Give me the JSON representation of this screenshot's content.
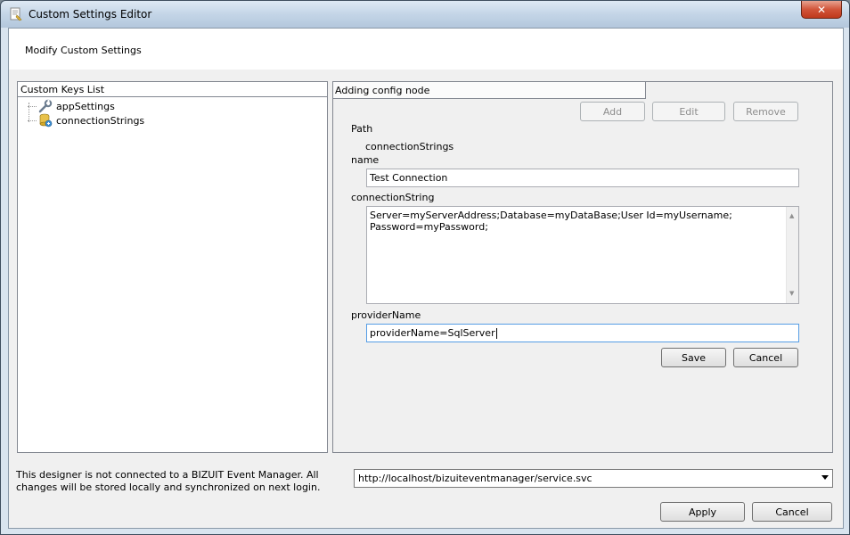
{
  "window": {
    "title": "Custom Settings Editor",
    "icon": "settings-document-icon",
    "close_glyph": "✕"
  },
  "header": {
    "text": "Modify Custom Settings"
  },
  "left_panel": {
    "title": "Custom Keys List",
    "tree_items": [
      {
        "label": "appSettings",
        "icon": "wrench-icon"
      },
      {
        "label": "connectionStrings",
        "icon": "database-connection-icon"
      }
    ]
  },
  "right_panel": {
    "tab_label": "Adding config node",
    "buttons": {
      "add": "Add",
      "edit": "Edit",
      "remove": "Remove",
      "save": "Save",
      "cancel": "Cancel"
    },
    "path_label": "Path",
    "path_value": "connectionStrings",
    "name_label": "name",
    "name_value": "Test Connection",
    "connection_label": "connectionString",
    "connection_value_line1": "Server=myServerAddress;Database=myDataBase;User Id=myUsername;",
    "connection_value_line2": "Password=myPassword;",
    "provider_label": "providerName",
    "provider_value": "providerName=SqlServer"
  },
  "footer": {
    "status_text": "This designer is not connected to a BIZUIT Event Manager. All changes will be stored locally and synchronized on next login.",
    "service_url": "http://localhost/bizuiteventmanager/service.svc",
    "apply_label": "Apply",
    "cancel_label": "Cancel"
  },
  "colors": {
    "close_button": "#c0391c",
    "focus_border": "#569de5"
  }
}
